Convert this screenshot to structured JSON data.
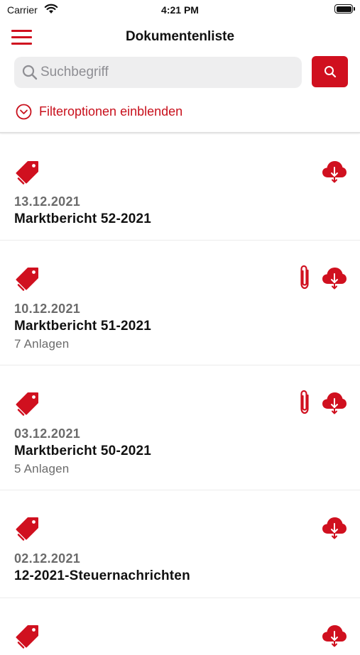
{
  "status_bar": {
    "carrier": "Carrier",
    "time": "4:21 PM"
  },
  "nav": {
    "title": "Dokumentenliste",
    "menu_icon": "hamburger-menu-icon"
  },
  "search": {
    "placeholder": "Suchbegriff",
    "value": "",
    "button_icon": "search-icon"
  },
  "filter": {
    "label": "Filteroptionen einblenden",
    "icon": "chevron-down-circle-icon"
  },
  "colors": {
    "accent": "#d0101f",
    "text_primary": "#111111",
    "text_secondary": "#6b6b6b",
    "search_bg": "#eeeeef"
  },
  "documents": [
    {
      "date": "13.12.2021",
      "title": "Marktbericht 52-2021",
      "attachments": "",
      "has_attachment": false,
      "icons": [
        "tag-icon",
        "cloud-download-icon"
      ]
    },
    {
      "date": "10.12.2021",
      "title": "Marktbericht 51-2021",
      "attachments": "7 Anlagen",
      "has_attachment": true,
      "icons": [
        "tag-icon",
        "paperclip-icon",
        "cloud-download-icon"
      ]
    },
    {
      "date": "03.12.2021",
      "title": "Marktbericht 50-2021",
      "attachments": "5 Anlagen",
      "has_attachment": true,
      "icons": [
        "tag-icon",
        "paperclip-icon",
        "cloud-download-icon"
      ]
    },
    {
      "date": "02.12.2021",
      "title": "12-2021-Steuernachrichten",
      "attachments": "",
      "has_attachment": false,
      "icons": [
        "tag-icon",
        "cloud-download-icon"
      ]
    },
    {
      "date": "",
      "title": "",
      "attachments": "",
      "has_attachment": false,
      "icons": [
        "tag-icon",
        "cloud-download-icon"
      ]
    }
  ]
}
